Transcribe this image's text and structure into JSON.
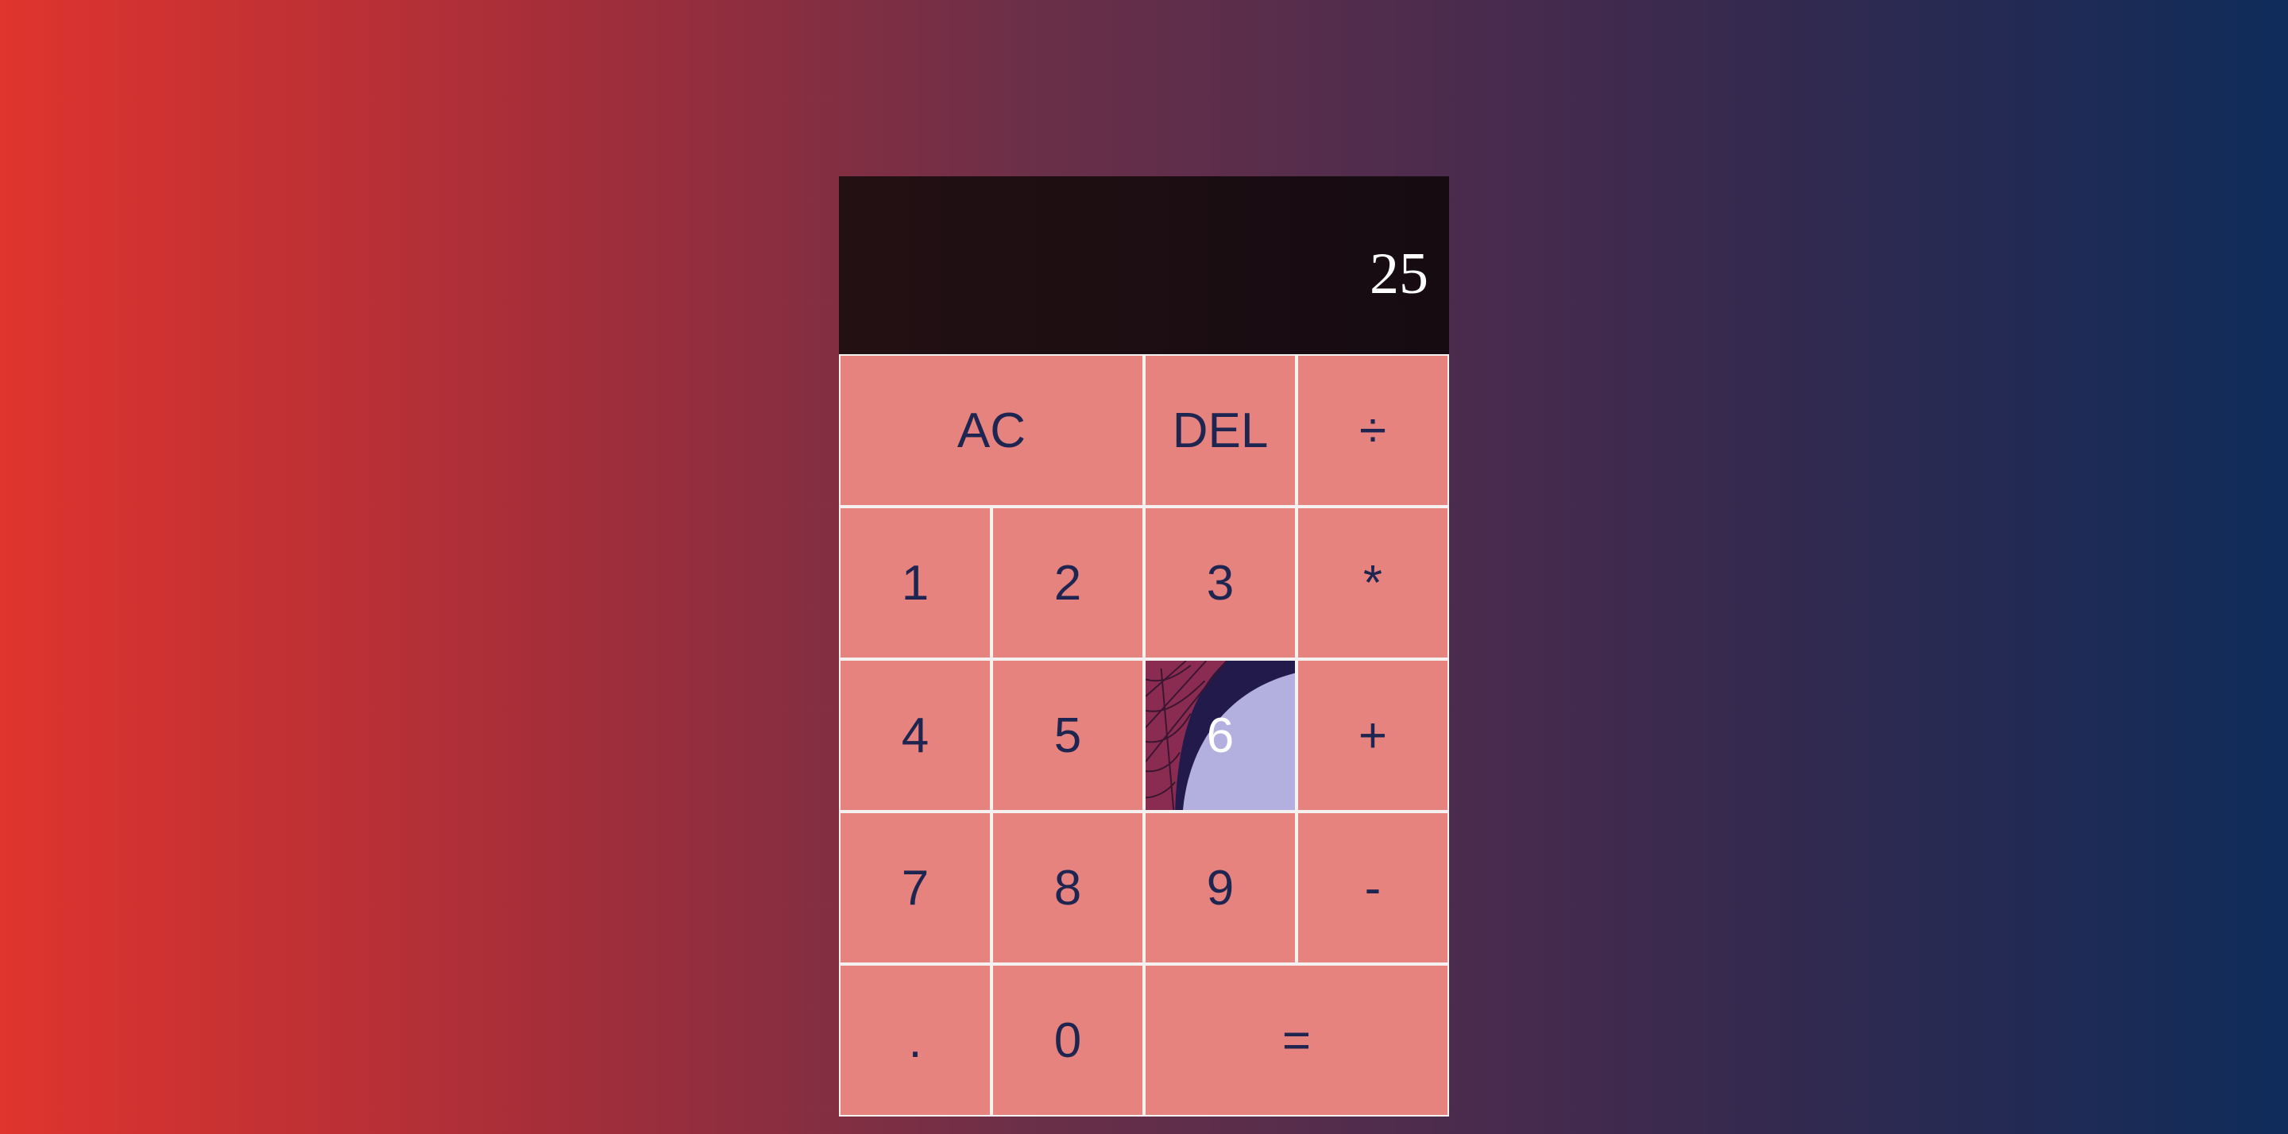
{
  "display": {
    "value": "25"
  },
  "keys": {
    "ac": "AC",
    "del": "DEL",
    "divide": "÷",
    "one": "1",
    "two": "2",
    "three": "3",
    "multiply": "*",
    "four": "4",
    "five": "5",
    "six": "6",
    "plus": "+",
    "seven": "7",
    "eight": "8",
    "nine": "9",
    "minus": "-",
    "decimal": ".",
    "zero": "0",
    "equals": "="
  },
  "colors": {
    "key_background": "#e6837e",
    "key_text": "#1d2550",
    "key_border": "#f4f1f1",
    "hover_background": "#b3afdf",
    "display_background": "#1c0d12"
  },
  "icons": {
    "hover_decoration": "spider-web-icon"
  }
}
